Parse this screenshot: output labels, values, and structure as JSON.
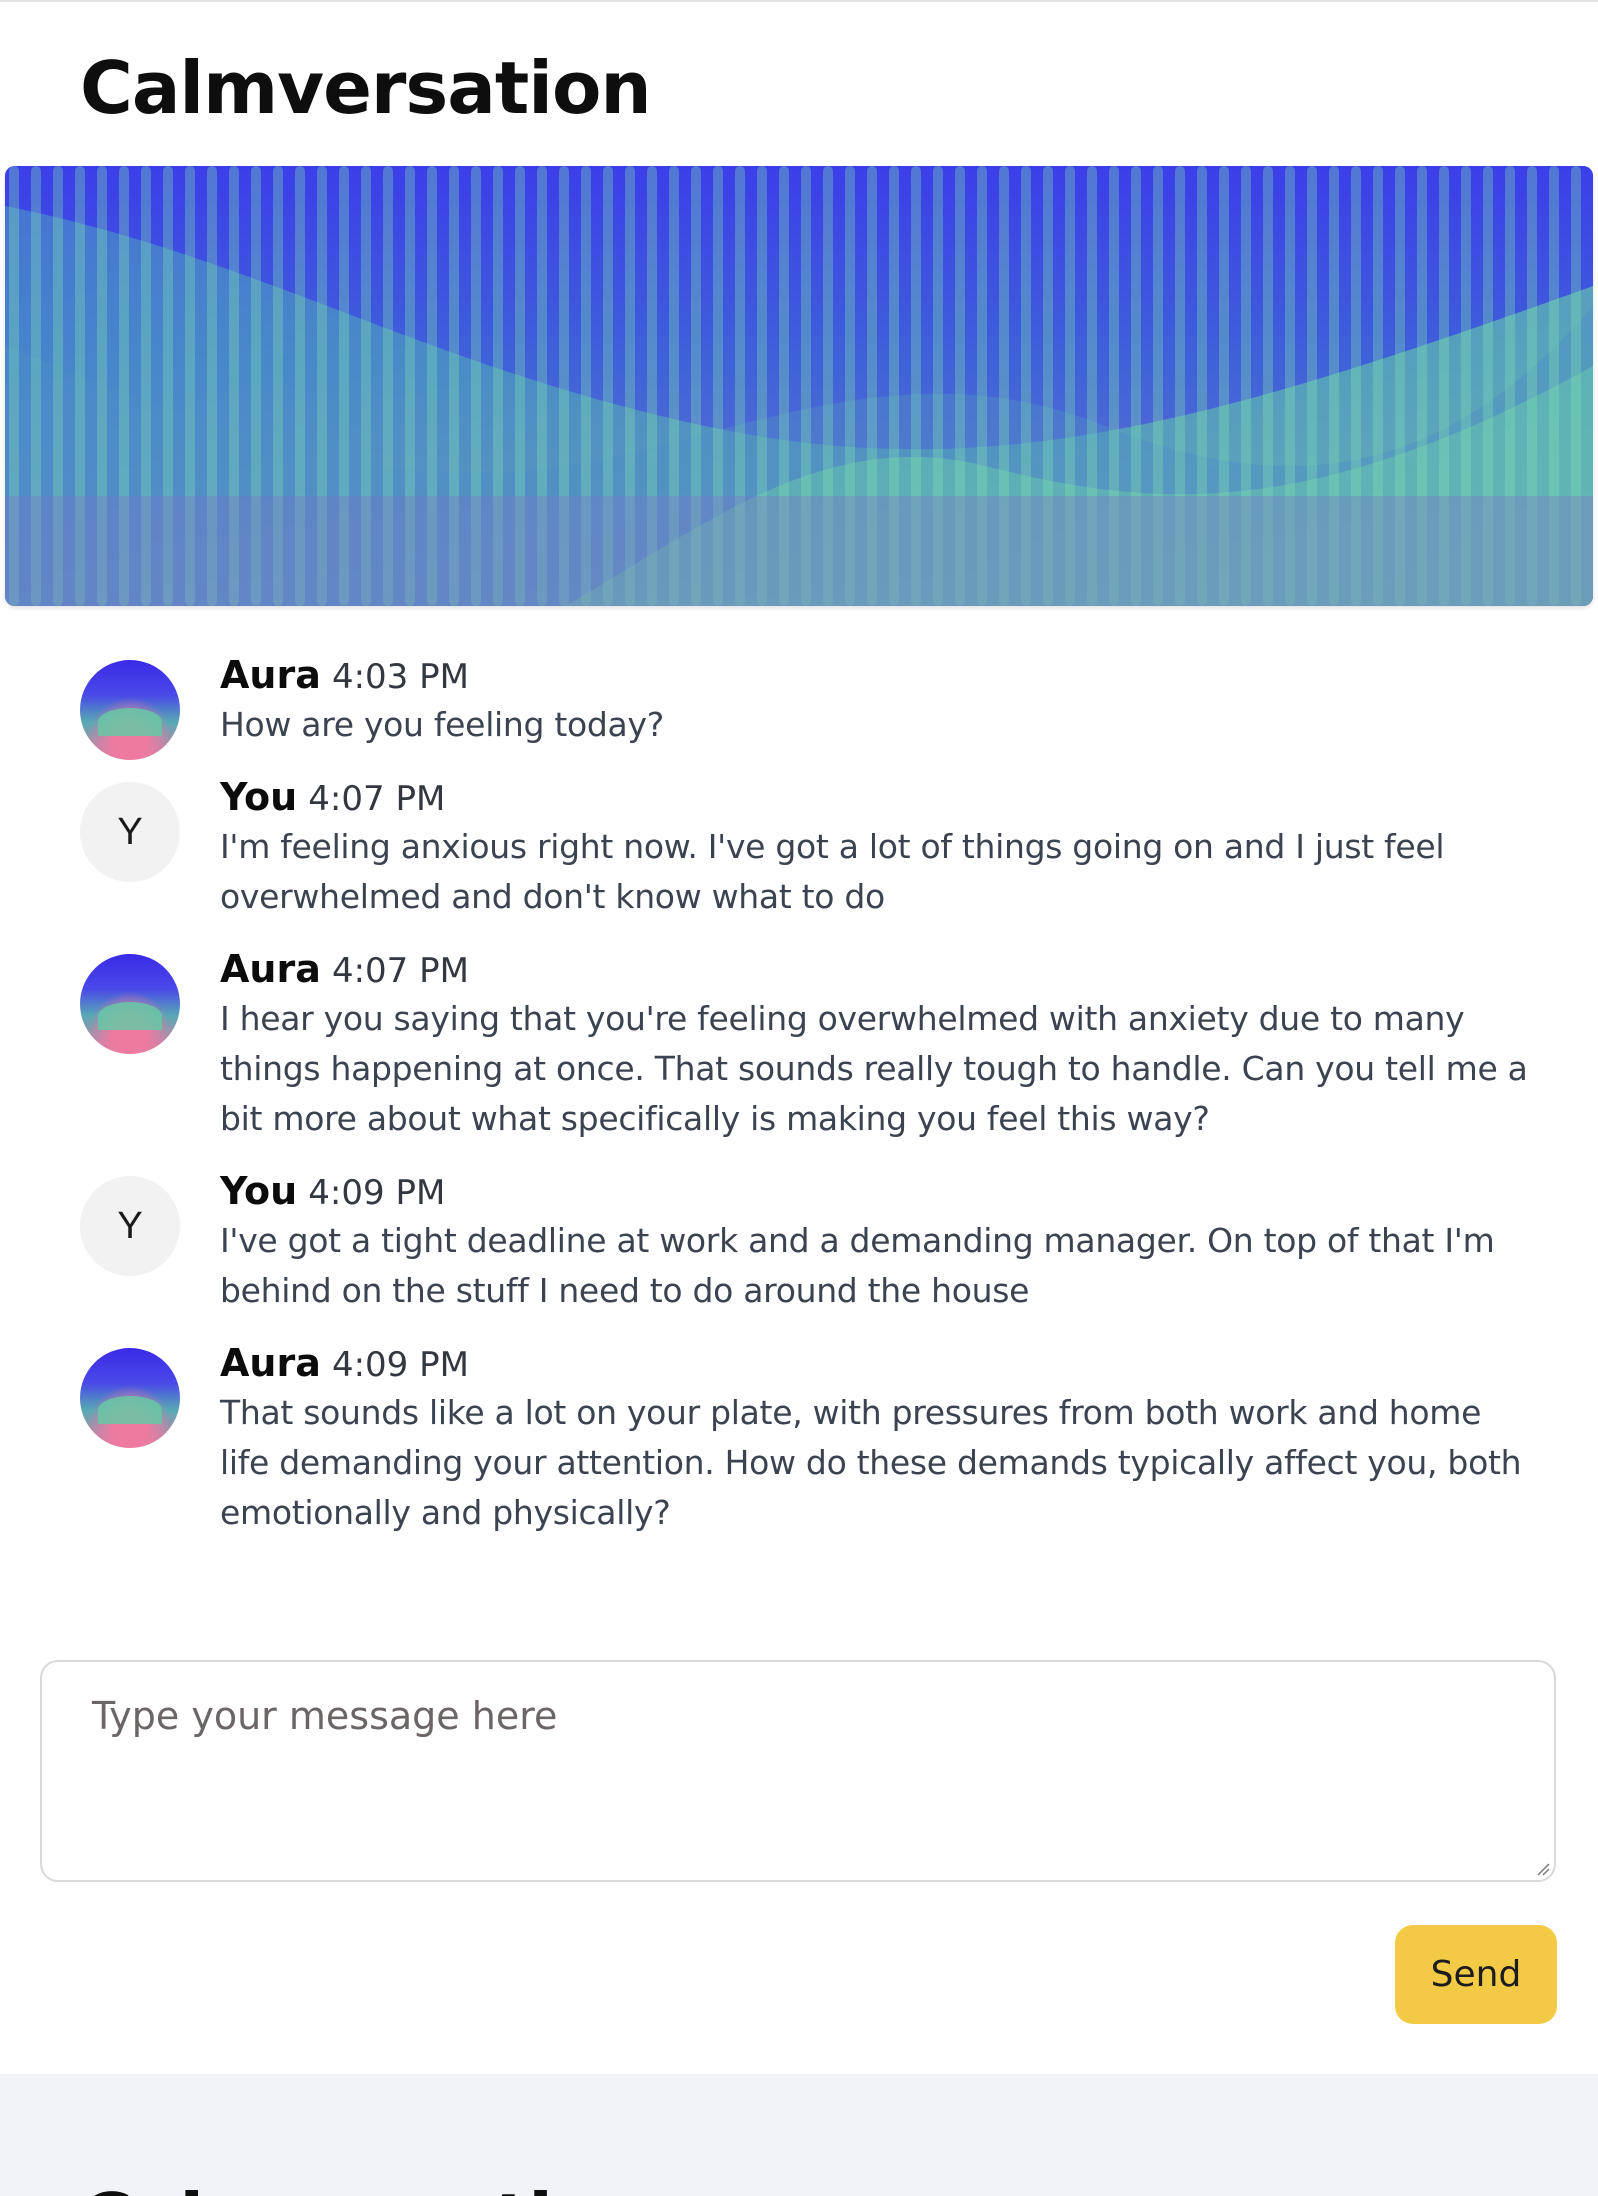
{
  "app": {
    "title": "Calmversation"
  },
  "messages": [
    {
      "sender": "Aura",
      "time": "4:03 PM",
      "text": "How are you feeling today?",
      "avatar": "aura-gradient-avatar"
    },
    {
      "sender": "You",
      "time": "4:07 PM",
      "text": "I'm feeling anxious right now. I've got a lot of things going on and I just feel overwhelmed and don't know what to do",
      "avatar_initial": "Y"
    },
    {
      "sender": "Aura",
      "time": "4:07 PM",
      "text": "I hear you saying that you're feeling overwhelmed with anxiety due to many things happening at once. That sounds really tough to handle. Can you tell me a bit more about what specifically is making you feel this way?",
      "avatar": "aura-gradient-avatar"
    },
    {
      "sender": "You",
      "time": "4:09 PM",
      "text": "I've got a tight deadline at work and a demanding manager. On top of that I'm behind on the stuff I need to do around the house",
      "avatar_initial": "Y"
    },
    {
      "sender": "Aura",
      "time": "4:09 PM",
      "text": "That sounds like a lot on your plate, with pressures from both work and home life demanding your attention. How do these demands typically affect you, both emotionally and physically?",
      "avatar": "aura-gradient-avatar"
    }
  ],
  "composer": {
    "placeholder": "Type your message here",
    "value": ""
  },
  "send": {
    "label": "Send"
  },
  "footer": {
    "title": "Calmversation"
  },
  "colors": {
    "accent_button": "#f3ca45",
    "hero_blue": "#3d3fe6",
    "hero_green": "#6fe3a0",
    "footer_bg": "#f1f3f8",
    "aura_pink": "#ef7aa0"
  },
  "icons": {
    "resize_grip": "resize-grip-icon"
  }
}
